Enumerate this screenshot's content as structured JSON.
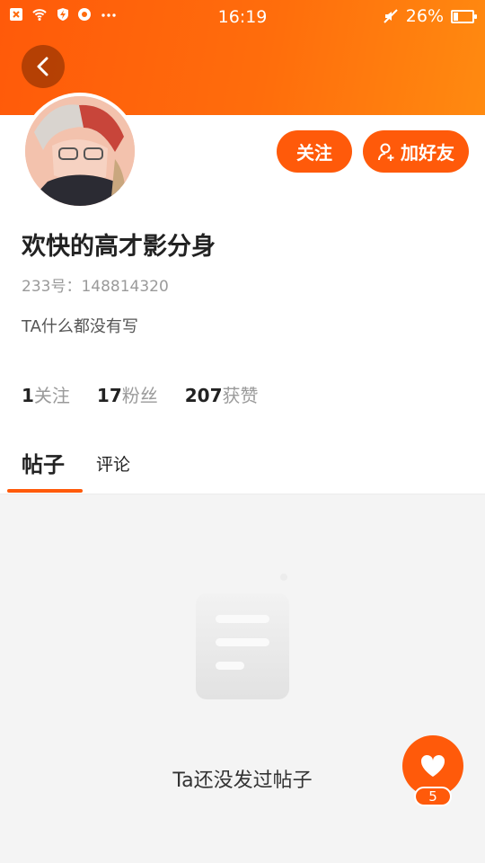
{
  "status_bar": {
    "time": "16:19",
    "battery_text": "26%",
    "battery_level": 0.26,
    "left_icons": [
      "notification-x-icon",
      "wifi-icon",
      "shield-bolt-icon",
      "app-icon",
      "more-dots-icon"
    ],
    "right_icons": [
      "mute-icon",
      "battery-icon"
    ]
  },
  "header": {
    "back_icon": "chevron-left-icon",
    "gradient_colors": [
      "#ff5a0a",
      "#ff8a10"
    ]
  },
  "profile": {
    "nickname": "欢快的高才影分身",
    "uid": "233号：148814320",
    "bio": "TA什么都没有写",
    "follow_label": "关注",
    "add_friend_label": "加好友",
    "add_friend_icon": "add-user-icon"
  },
  "stats": [
    {
      "num": "1",
      "label": "关注"
    },
    {
      "num": "17",
      "label": "粉丝"
    },
    {
      "num": "207",
      "label": "获赞"
    }
  ],
  "tabs": [
    {
      "label": "帖子",
      "active": true
    },
    {
      "label": "评论",
      "active": false
    }
  ],
  "empty_state": {
    "icon": "document-icon",
    "text": "Ta还没发过帖子"
  },
  "fab": {
    "icon": "heart-icon",
    "count": "5"
  },
  "colors": {
    "accent": "#ff5a0a",
    "background": "#f4f4f4"
  }
}
